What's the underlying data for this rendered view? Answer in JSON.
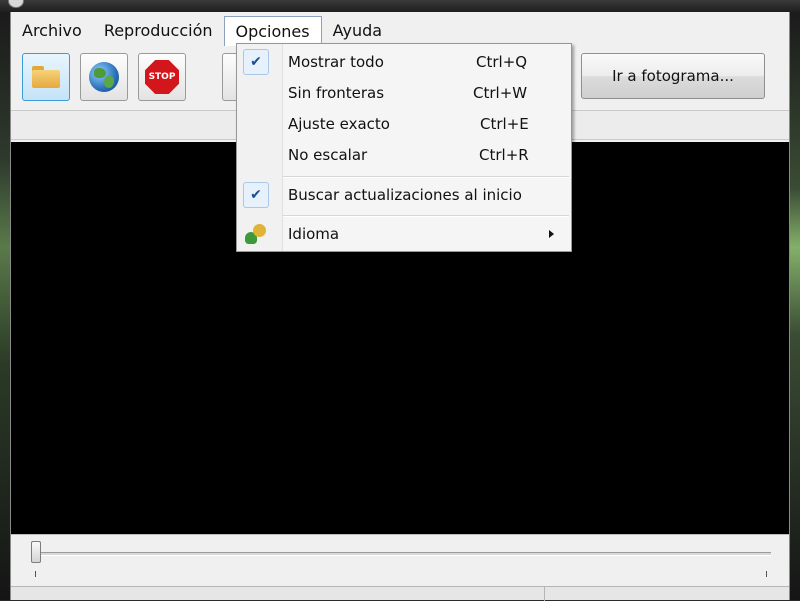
{
  "menubar": {
    "items": [
      "Archivo",
      "Reproducción",
      "Opciones",
      "Ayuda"
    ]
  },
  "toolbar": {
    "open_icon": "folder-icon",
    "url_icon": "globe-icon",
    "stop_label": "STOP",
    "goto_label": "Ir a fotograma..."
  },
  "options_menu": {
    "items": [
      {
        "label": "Mostrar todo",
        "shortcut": "Ctrl+Q",
        "checked": true
      },
      {
        "label": "Sin fronteras",
        "shortcut": "Ctrl+W",
        "checked": false
      },
      {
        "label": "Ajuste exacto",
        "shortcut": "Ctrl+E",
        "checked": false
      },
      {
        "label": "No escalar",
        "shortcut": "Ctrl+R",
        "checked": false
      },
      {
        "label": "Buscar actualizaciones al inicio",
        "checked": true
      },
      {
        "label": "Idioma",
        "icon": "language-icon",
        "submenu": true
      }
    ]
  },
  "colors": {
    "video_bg": "#000000",
    "menu_bg": "#f5f5f5",
    "accent": "#3c9ad6"
  }
}
